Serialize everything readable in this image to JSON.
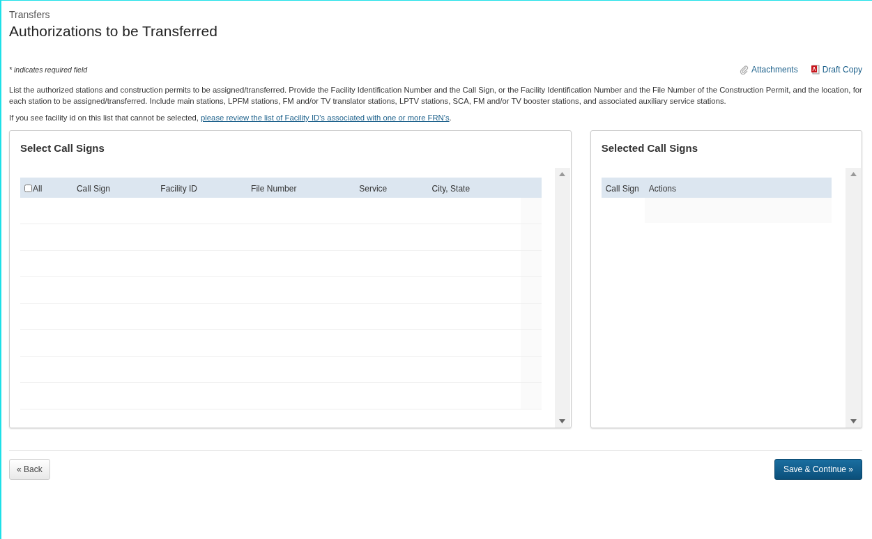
{
  "breadcrumb": "Transfers",
  "title": "Authorizations to be Transferred",
  "required_note": "* indicates required field",
  "links": [
    {
      "kind": "attachment",
      "label": "Attachments"
    },
    {
      "kind": "pdf",
      "label": "Draft Copy"
    }
  ],
  "instructions": "List the authorized stations and construction permits to be assigned/transferred. Provide the Facility Identification Number and the Call Sign, or the Facility Identification Number and the File Number of the Construction Permit, and the location, for each station to be assigned/transferred. Include main stations, LPFM stations, FM and/or TV translator stations, LPTV stations, SCA, FM and/or TV booster stations, and associated auxiliary service stations.",
  "facility_note": {
    "text": "If you see facility id on this list that cannot be selected, ",
    "link": "please review the list of Facility ID's associated with one or more FRN's",
    "after": "."
  },
  "select_panel": {
    "title": "Select Call Signs",
    "select_all": {
      "label": "All",
      "checked": false
    },
    "columns": [
      "Call Sign",
      "Facility ID",
      "File Number",
      "Service",
      "City, State"
    ]
  },
  "selected_panel": {
    "title": "Selected Call Signs",
    "columns": [
      "Call Sign",
      "Actions"
    ]
  },
  "buttons": [
    {
      "kind": "back",
      "label": "« Back"
    },
    {
      "kind": "primary",
      "label": "Save & Continue »"
    }
  ]
}
